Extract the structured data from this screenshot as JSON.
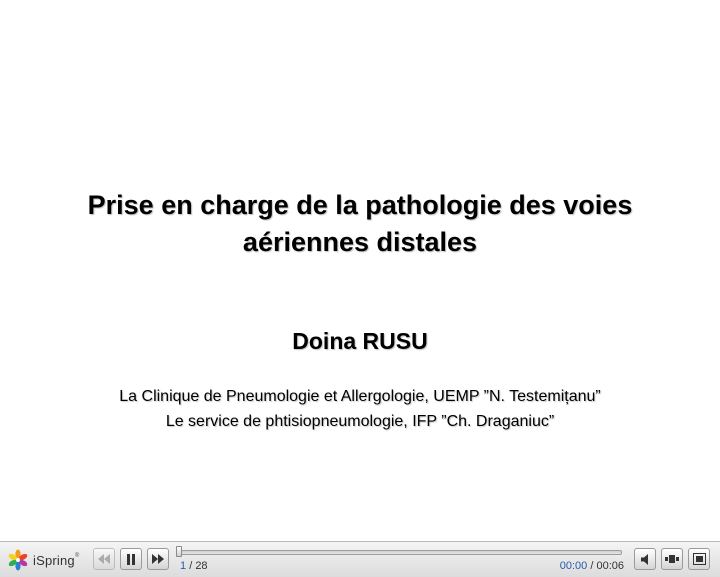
{
  "slide": {
    "title_line1": "Prise en charge de la pathologie des voies",
    "title_line2": "aériennes distales",
    "author": "Doina RUSU",
    "affiliation_line1": "La Clinique de Pneumologie et Allergologie, UEMP ”N. Testemițanu”",
    "affiliation_line2": "Le service de phtisiopneumologie, IFP ”Ch. Draganiuc”"
  },
  "player": {
    "brand": "iSpring",
    "brand_mark": "®",
    "current_slide": "1",
    "slide_separator": "/",
    "total_slides": "28",
    "elapsed_time": "00:00",
    "time_separator": "/",
    "total_time": "00:06",
    "progress_fraction": 0.0,
    "controls": {
      "prev": "rewind-icon",
      "pause": "pause-icon",
      "next": "fast-forward-icon",
      "audio": "speaker-icon",
      "slides": "slide-list-icon",
      "fullscreen": "fullscreen-icon"
    }
  },
  "colors": {
    "accent": "#2a5caa",
    "bar_bg": "#e4e4e4"
  }
}
